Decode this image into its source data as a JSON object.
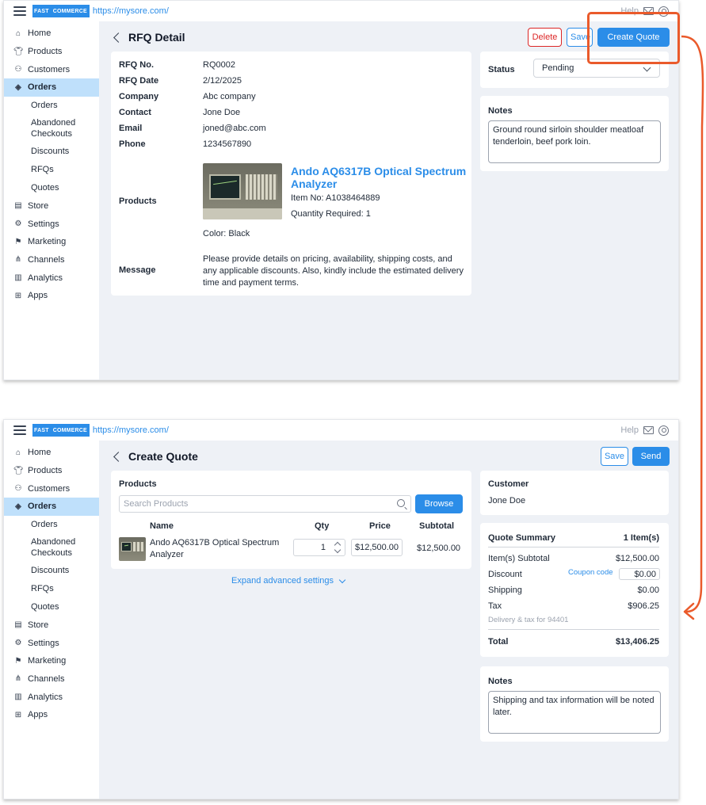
{
  "colors": {
    "accent": "#2b8de8",
    "danger": "#dc2626",
    "highlight": "#ea5a2b",
    "content_bg": "#eef1f6",
    "active_nav": "#bfe0fb"
  },
  "app": {
    "logo_fast": "FAST",
    "logo_commerce": "COMMERCE",
    "url": "https://mysore.com/",
    "help": "Help"
  },
  "sidebar": {
    "home": "Home",
    "products": "Products",
    "customers": "Customers",
    "orders": "Orders",
    "sub_orders": "Orders",
    "sub_abandoned": "Abandoned Checkouts",
    "sub_discounts": "Discounts",
    "sub_rfqs": "RFQs",
    "sub_quotes": "Quotes",
    "store": "Store",
    "settings": "Settings",
    "marketing": "Marketing",
    "channels": "Channels",
    "analytics": "Analytics",
    "apps": "Apps"
  },
  "rfq": {
    "title": "RFQ Detail",
    "delete": "Delete",
    "save": "Save",
    "create_quote": "Create Quote",
    "rfq_no_label": "RFQ No.",
    "rfq_no": "RQ0002",
    "rfq_date_label": "RFQ Date",
    "rfq_date": "2/12/2025",
    "company_label": "Company",
    "company": "Abc company",
    "contact_label": "Contact",
    "contact": "Jone Doe",
    "email_label": "Email",
    "email": "joned@abc.com",
    "phone_label": "Phone",
    "phone": "1234567890",
    "products_label": "Products",
    "product_name": "Ando AQ6317B Optical Spectrum Analyzer",
    "item_no": "Item No: A1038464889",
    "qty_required": "Quantity Required: 1",
    "color": "Color: Black",
    "message_label": "Message",
    "message": "Please provide details on pricing, availability, shipping costs, and any applicable discounts. Also, kindly include the estimated delivery time and payment terms.",
    "status_label": "Status",
    "status_value": "Pending",
    "notes_label": "Notes",
    "notes": "Ground round sirloin shoulder meatloaf tenderloin, beef pork loin."
  },
  "quote": {
    "title": "Create Quote",
    "save": "Save",
    "send": "Send",
    "products_label": "Products",
    "search_placeholder": "Search Products",
    "browse": "Browse",
    "col_name": "Name",
    "col_qty": "Qty",
    "col_price": "Price",
    "col_subtotal": "Subtotal",
    "row_name": "Ando AQ6317B Optical Spectrum Analyzer",
    "row_qty": "1",
    "row_price": "$12,500.00",
    "row_subtotal": "$12,500.00",
    "expand": "Expand advanced settings",
    "customer_label": "Customer",
    "customer": "Jone Doe",
    "summary_label": "Quote Summary",
    "summary_items": "1 Item(s)",
    "items_subtotal_label": "Item(s) Subtotal",
    "items_subtotal": "$12,500.00",
    "discount_label": "Discount",
    "coupon_code": "Coupon code",
    "discount": "$0.00",
    "shipping_label": "Shipping",
    "shipping": "$0.00",
    "tax_label": "Tax",
    "tax": "$906.25",
    "delivery_note": "Delivery & tax for 94401",
    "total_label": "Total",
    "total": "$13,406.25",
    "notes_label": "Notes",
    "notes": "Shipping and tax information will be noted later."
  }
}
